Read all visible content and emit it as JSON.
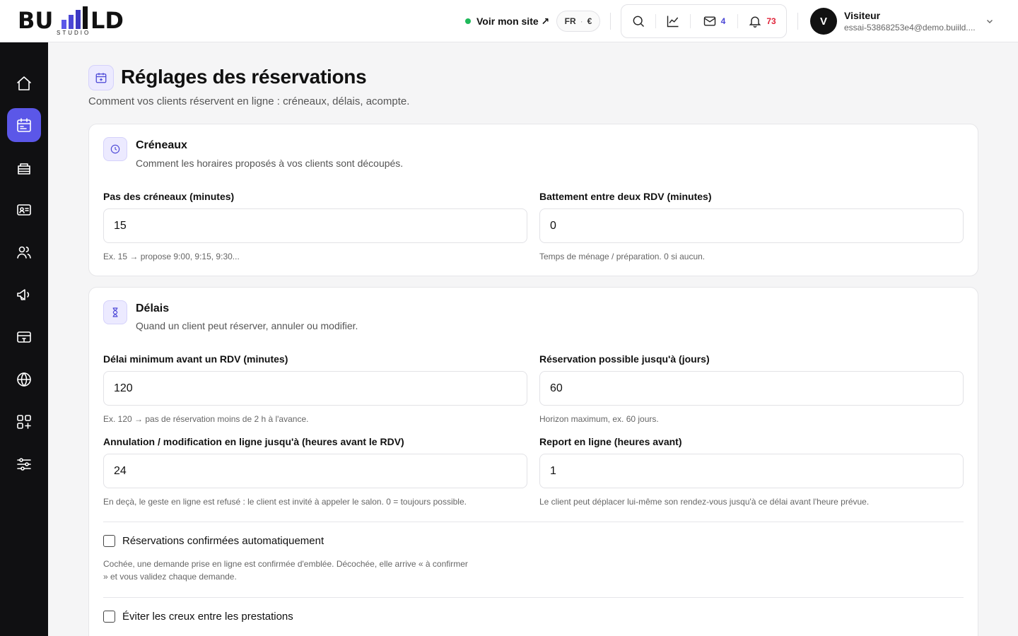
{
  "brand": {
    "name": "BU  LD",
    "sub": "STUDIO"
  },
  "header": {
    "site_link": "Voir mon site ↗",
    "language": "FR",
    "currency": "€",
    "messages_count": "4",
    "notifications_count": "73",
    "user": {
      "initial": "V",
      "name": "Visiteur",
      "email": "essai-53868253e4@demo.buiild...."
    }
  },
  "sidebar": {
    "items": [
      {
        "icon": "home-icon"
      },
      {
        "icon": "calendar-icon",
        "active": true
      },
      {
        "icon": "services-icon"
      },
      {
        "icon": "contact-card-icon"
      },
      {
        "icon": "users-icon"
      },
      {
        "icon": "megaphone-icon"
      },
      {
        "icon": "payment-icon"
      },
      {
        "icon": "globe-icon"
      },
      {
        "icon": "apps-icon"
      },
      {
        "icon": "sliders-icon"
      }
    ]
  },
  "page": {
    "title": "Réglages des réservations",
    "subtitle": "Comment vos clients réservent en ligne : créneaux, délais, acompte."
  },
  "slots": {
    "title": "Créneaux",
    "subtitle": "Comment les horaires proposés à vos clients sont découpés.",
    "step": {
      "label": "Pas des créneaux (minutes)",
      "value": "15",
      "hint": "Ex. 15 → propose 9:00, 9:15, 9:30..."
    },
    "buffer": {
      "label": "Battement entre deux RDV (minutes)",
      "value": "0",
      "hint": "Temps de ménage / préparation. 0 si aucun."
    }
  },
  "delays": {
    "title": "Délais",
    "subtitle": "Quand un client peut réserver, annuler ou modifier.",
    "min_notice": {
      "label": "Délai minimum avant un RDV (minutes)",
      "value": "120",
      "hint": "Ex. 120 → pas de réservation moins de 2 h à l'avance."
    },
    "max_horizon": {
      "label": "Réservation possible jusqu'à (jours)",
      "value": "60",
      "hint": "Horizon maximum, ex. 60 jours."
    },
    "cancel": {
      "label": "Annulation / modification en ligne jusqu'à (heures avant le RDV)",
      "value": "24",
      "hint": "En deçà, le geste en ligne est refusé : le client est invité à appeler le salon. 0 = toujours possible."
    },
    "reschedule": {
      "label": "Report en ligne (heures avant)",
      "value": "1",
      "hint": "Le client peut déplacer lui-même son rendez-vous jusqu'à ce délai avant l'heure prévue."
    },
    "auto_confirm": {
      "label": "Réservations confirmées automatiquement",
      "checked": false,
      "hint": "Cochée, une demande prise en ligne est confirmée d'emblée. Décochée, elle arrive « à confirmer » et vous validez chaque demande."
    },
    "avoid_gaps": {
      "label": "Éviter les creux entre les prestations",
      "checked": false
    }
  },
  "colors": {
    "accent": "#5b57e8",
    "sidebar": "#101012",
    "online": "#1fb95a",
    "alert": "#e0243a"
  }
}
